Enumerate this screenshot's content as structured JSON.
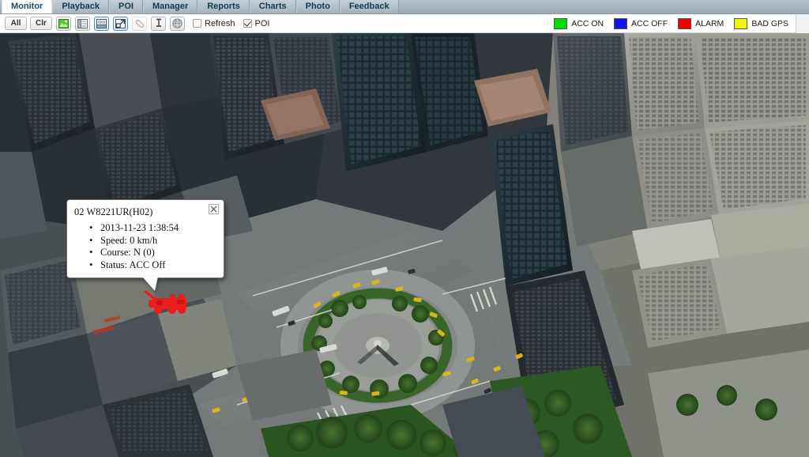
{
  "tabs": [
    {
      "label": "Monitor",
      "active": true
    },
    {
      "label": "Playback",
      "active": false
    },
    {
      "label": "POI",
      "active": false
    },
    {
      "label": "Manager",
      "active": false
    },
    {
      "label": "Reports",
      "active": false
    },
    {
      "label": "Charts",
      "active": false
    },
    {
      "label": "Photo",
      "active": false
    },
    {
      "label": "Feedback",
      "active": false
    }
  ],
  "toolbar": {
    "all_label": "All",
    "clr_label": "Clr",
    "icons": [
      {
        "name": "map-image-icon",
        "selected": false,
        "disabled": false
      },
      {
        "name": "panel-left-icon",
        "selected": false,
        "disabled": false
      },
      {
        "name": "panel-bottom-icon",
        "selected": true,
        "disabled": false
      },
      {
        "name": "expand-fullscreen-icon",
        "selected": true,
        "disabled": false
      },
      {
        "name": "link-chain-icon",
        "selected": false,
        "disabled": true
      },
      {
        "name": "pin-marker-icon",
        "selected": false,
        "disabled": false
      },
      {
        "name": "globe-icon",
        "selected": false,
        "disabled": false
      }
    ],
    "refresh": {
      "label": "Refresh",
      "checked": false
    },
    "poi": {
      "label": "POI",
      "checked": true
    }
  },
  "legend": [
    {
      "label": "ACC ON",
      "color": "#00dd00"
    },
    {
      "label": "ACC OFF",
      "color": "#1414e6"
    },
    {
      "label": "ALARM",
      "color": "#ee0000"
    },
    {
      "label": "BAD GPS",
      "color": "#f5f500"
    }
  ],
  "popup": {
    "title": "02 W8221UR(H02)",
    "close_icon": "close-icon",
    "details": [
      "2013-11-23 1:38:54",
      "Speed: 0 km/h",
      "Course: N (0)",
      "Status: ACC Off"
    ]
  },
  "marker": {
    "name": "vehicle-marker",
    "color": "#ee1c1c"
  },
  "map": {
    "description": "Aerial satellite imagery of Columbus Circle, New York City"
  }
}
